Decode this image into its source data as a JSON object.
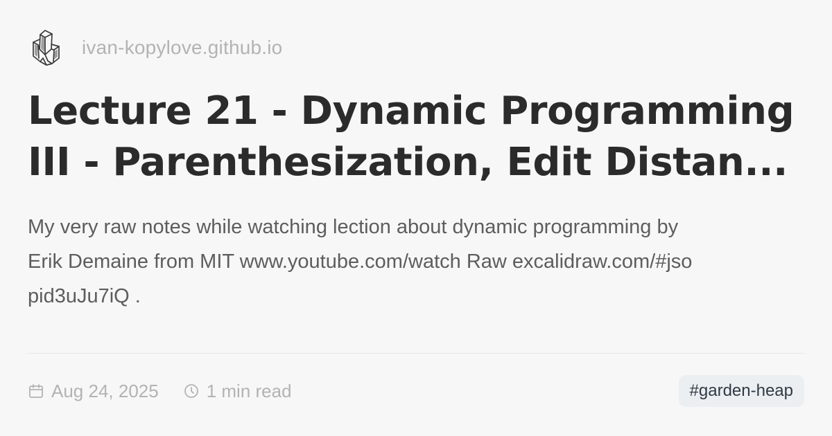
{
  "site": {
    "logo_icon": "crystal-icon",
    "url": "ivan-kopylove.github.io"
  },
  "post": {
    "title": "Lecture 21 - Dynamic Programming III - Parenthesization, Edit Distan...",
    "description_lines": [
      "My very raw notes while watching lection about dynamic programming by",
      "Erik Demaine from MIT www.youtube.com/watch Raw excalidraw.com/#jso",
      "pid3uJu7iQ ."
    ]
  },
  "meta": {
    "date_icon": "calendar-icon",
    "date": "Aug 24, 2025",
    "read_icon": "clock-icon",
    "reading_time": "1 min read"
  },
  "tag": {
    "label": "#garden-heap"
  },
  "colors": {
    "background": "#f8f7f8",
    "title": "#2b2b2b",
    "muted": "#b3b3b3",
    "description": "#5d5d5d",
    "tag_background": "#eceff1"
  }
}
